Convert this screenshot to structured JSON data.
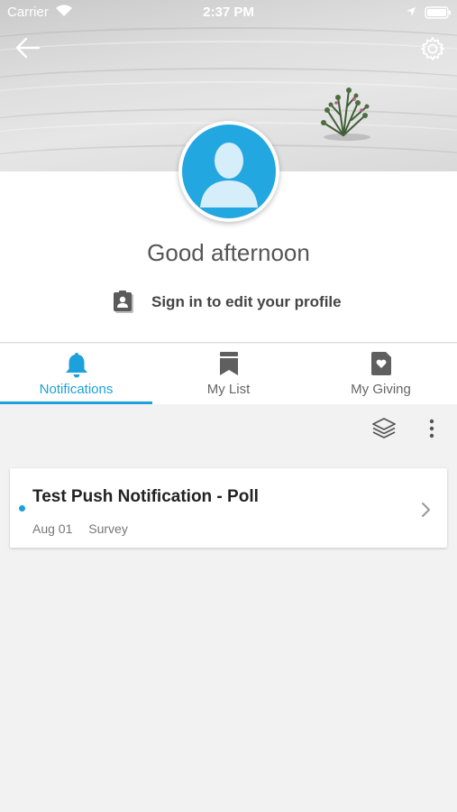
{
  "status_bar": {
    "carrier": "Carrier",
    "time": "2:37 PM"
  },
  "header": {
    "back_icon": "arrow-left-icon",
    "settings_icon": "gear-icon"
  },
  "profile": {
    "greeting": "Good afternoon",
    "signin_label": "Sign in to edit your profile",
    "avatar_icon": "person-silhouette-icon"
  },
  "tabs": [
    {
      "label": "Notifications",
      "icon": "bell-icon",
      "active": true
    },
    {
      "label": "My List",
      "icon": "bookmark-icon",
      "active": false
    },
    {
      "label": "My Giving",
      "icon": "heart-tag-icon",
      "active": false
    }
  ],
  "toolbar": {
    "layers_icon": "layers-icon",
    "more_icon": "more-vertical-icon"
  },
  "notifications": [
    {
      "title": "Test Push Notification - Poll",
      "date": "Aug 01",
      "type": "Survey",
      "unread": true
    }
  ],
  "colors": {
    "accent": "#1da1db",
    "avatar": "#22a7e0"
  }
}
